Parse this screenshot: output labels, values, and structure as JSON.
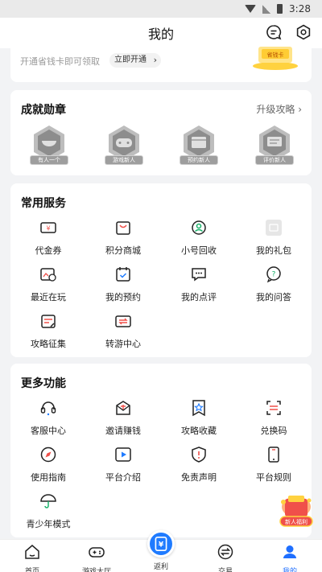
{
  "status_bar": {
    "time": "3:28"
  },
  "header": {
    "title": "我的"
  },
  "vip": {
    "text": "开通省钱卡即可领取",
    "button": "立即开通",
    "card_label": "省钱卡"
  },
  "badges": {
    "title": "成就勋章",
    "more": "升级攻略",
    "items": [
      {
        "label": "有人一个",
        "icon": "bowl-icon"
      },
      {
        "label": "游戏新人",
        "icon": "gamepad-icon"
      },
      {
        "label": "预约新人",
        "icon": "calendar-icon"
      },
      {
        "label": "评价新人",
        "icon": "comment-icon"
      }
    ]
  },
  "services": {
    "title": "常用服务",
    "items": [
      {
        "label": "代金券",
        "icon": "voucher-icon"
      },
      {
        "label": "积分商城",
        "icon": "mall-icon"
      },
      {
        "label": "小号回收",
        "icon": "recycle-icon"
      },
      {
        "label": "我的礼包",
        "icon": "gift-box-icon"
      },
      {
        "label": "最近在玩",
        "icon": "recent-play-icon"
      },
      {
        "label": "我的预约",
        "icon": "reservation-icon"
      },
      {
        "label": "我的点评",
        "icon": "review-icon"
      },
      {
        "label": "我的问答",
        "icon": "qa-icon"
      },
      {
        "label": "攻略征集",
        "icon": "guide-collect-icon"
      },
      {
        "label": "转游中心",
        "icon": "transfer-icon"
      }
    ]
  },
  "more_features": {
    "title": "更多功能",
    "items": [
      {
        "label": "客服中心",
        "icon": "headset-icon"
      },
      {
        "label": "邀请赚钱",
        "icon": "invite-icon"
      },
      {
        "label": "攻略收藏",
        "icon": "star-bookmark-icon"
      },
      {
        "label": "兑换码",
        "icon": "redeem-code-icon"
      },
      {
        "label": "使用指南",
        "icon": "compass-icon"
      },
      {
        "label": "平台介绍",
        "icon": "play-video-icon"
      },
      {
        "label": "免责声明",
        "icon": "disclaimer-icon"
      },
      {
        "label": "平台规则",
        "icon": "phone-rules-icon"
      },
      {
        "label": "青少年模式",
        "icon": "umbrella-icon"
      }
    ]
  },
  "float_gift": {
    "label": "新人福利"
  },
  "tabs": [
    {
      "label": "首页",
      "icon": "home-icon"
    },
    {
      "label": "游戏大厅",
      "icon": "game-hall-icon"
    },
    {
      "label": "返利",
      "icon": "rebate-icon"
    },
    {
      "label": "交易",
      "icon": "trade-icon"
    },
    {
      "label": "我的",
      "icon": "profile-icon"
    }
  ],
  "colors": {
    "accent": "#1f7bff",
    "badge_gray": "#9e9e9e",
    "orange": "#ff8a3d",
    "red": "#f0504a"
  }
}
